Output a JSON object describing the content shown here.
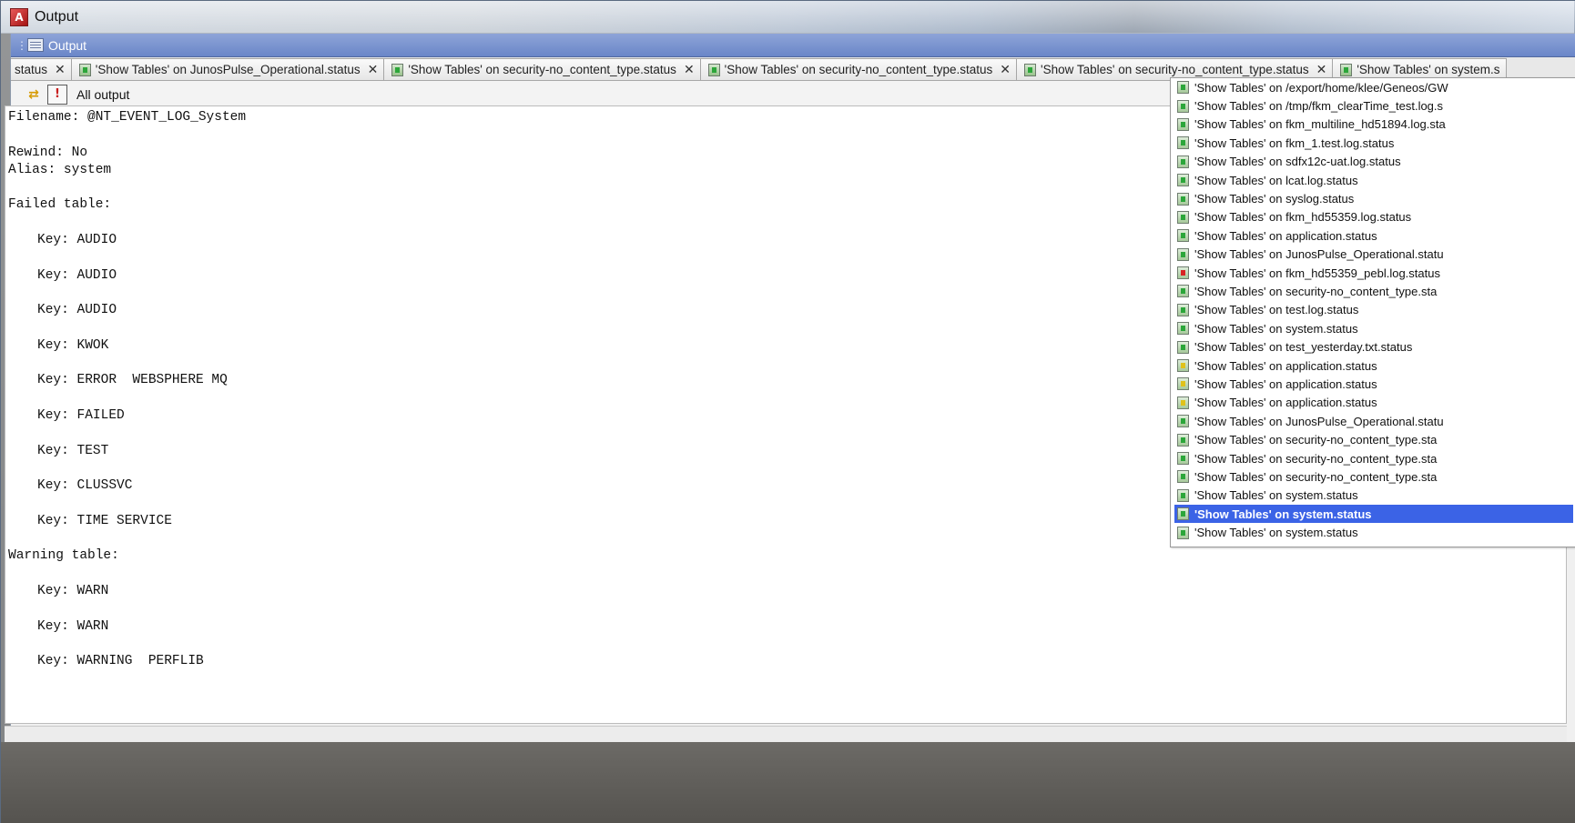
{
  "window": {
    "title": "Output"
  },
  "view": {
    "title": "Output"
  },
  "tabs": [
    {
      "label": "status",
      "first": true,
      "has_icon": false
    },
    {
      "label": "'Show Tables' on JunosPulse_Operational.status",
      "has_icon": true
    },
    {
      "label": "'Show Tables' on security-no_content_type.status",
      "has_icon": true
    },
    {
      "label": "'Show Tables' on security-no_content_type.status",
      "has_icon": true
    },
    {
      "label": "'Show Tables' on security-no_content_type.status",
      "has_icon": true
    },
    {
      "label": "'Show Tables' on system.s",
      "has_icon": true,
      "no_close": true
    }
  ],
  "toolbar": {
    "label": "All output",
    "refresh_icon": "refresh-icon",
    "alert_icon": "alert-icon"
  },
  "output": {
    "lines": [
      {
        "text": "Filename: @NT_EVENT_LOG_System",
        "indent": false
      },
      {
        "text": "",
        "indent": false
      },
      {
        "text": "Rewind: No",
        "indent": false
      },
      {
        "text": "Alias: system",
        "indent": false
      },
      {
        "text": "",
        "indent": false
      },
      {
        "text": "Failed table:",
        "indent": false
      },
      {
        "text": "",
        "indent": false
      },
      {
        "text": "Key: AUDIO",
        "indent": true
      },
      {
        "text": "",
        "indent": false
      },
      {
        "text": "Key: AUDIO",
        "indent": true
      },
      {
        "text": "",
        "indent": false
      },
      {
        "text": "Key: AUDIO",
        "indent": true
      },
      {
        "text": "",
        "indent": false
      },
      {
        "text": "Key: KWOK",
        "indent": true
      },
      {
        "text": "",
        "indent": false
      },
      {
        "text": "Key: ERROR  WEBSPHERE MQ",
        "indent": true
      },
      {
        "text": "",
        "indent": false
      },
      {
        "text": "Key: FAILED",
        "indent": true
      },
      {
        "text": "",
        "indent": false
      },
      {
        "text": "Key: TEST",
        "indent": true
      },
      {
        "text": "",
        "indent": false
      },
      {
        "text": "Key: CLUSSVC",
        "indent": true
      },
      {
        "text": "",
        "indent": false
      },
      {
        "text": "Key: TIME SERVICE",
        "indent": true
      },
      {
        "text": "",
        "indent": false
      },
      {
        "text": "Warning table:",
        "indent": false
      },
      {
        "text": "",
        "indent": false
      },
      {
        "text": "Key: WARN",
        "indent": true
      },
      {
        "text": "",
        "indent": false
      },
      {
        "text": "Key: WARN",
        "indent": true
      },
      {
        "text": "",
        "indent": false
      },
      {
        "text": "Key: WARNING  PERFLIB",
        "indent": true
      }
    ]
  },
  "dropdown": {
    "items": [
      {
        "label": "'Show Tables' on /export/home/klee/Geneos/GW",
        "status": "ok"
      },
      {
        "label": "'Show Tables' on /tmp/fkm_clearTime_test.log.s",
        "status": "ok"
      },
      {
        "label": "'Show Tables' on fkm_multiline_hd51894.log.sta",
        "status": "ok"
      },
      {
        "label": "'Show Tables' on fkm_1.test.log.status",
        "status": "ok"
      },
      {
        "label": "'Show Tables' on sdfx12c-uat.log.status",
        "status": "ok"
      },
      {
        "label": "'Show Tables' on lcat.log.status",
        "status": "ok"
      },
      {
        "label": "'Show Tables' on syslog.status",
        "status": "ok"
      },
      {
        "label": "'Show Tables' on fkm_hd55359.log.status",
        "status": "ok"
      },
      {
        "label": "'Show Tables' on application.status",
        "status": "ok"
      },
      {
        "label": "'Show Tables' on JunosPulse_Operational.statu",
        "status": "ok"
      },
      {
        "label": "'Show Tables' on fkm_hd55359_pebl.log.status",
        "status": "err"
      },
      {
        "label": "'Show Tables' on security-no_content_type.sta",
        "status": "ok"
      },
      {
        "label": "'Show Tables' on test.log.status",
        "status": "ok"
      },
      {
        "label": "'Show Tables' on system.status",
        "status": "ok"
      },
      {
        "label": "'Show Tables' on test_yesterday.txt.status",
        "status": "ok"
      },
      {
        "label": "'Show Tables' on application.status",
        "status": "warn"
      },
      {
        "label": "'Show Tables' on application.status",
        "status": "warn"
      },
      {
        "label": "'Show Tables' on application.status",
        "status": "warn"
      },
      {
        "label": "'Show Tables' on JunosPulse_Operational.statu",
        "status": "ok"
      },
      {
        "label": "'Show Tables' on security-no_content_type.sta",
        "status": "ok"
      },
      {
        "label": "'Show Tables' on security-no_content_type.sta",
        "status": "ok"
      },
      {
        "label": "'Show Tables' on security-no_content_type.sta",
        "status": "ok"
      },
      {
        "label": "'Show Tables' on system.status",
        "status": "ok"
      },
      {
        "label": "'Show Tables' on system.status",
        "status": "ok",
        "selected": true
      },
      {
        "label": "'Show Tables' on system.status",
        "status": "ok"
      }
    ]
  },
  "colors": {
    "view_header": "#7a94d0",
    "selection": "#3b63e6",
    "ok_icon": "#2ca63a",
    "warn_icon": "#e0c21a",
    "err_icon": "#d82424"
  }
}
